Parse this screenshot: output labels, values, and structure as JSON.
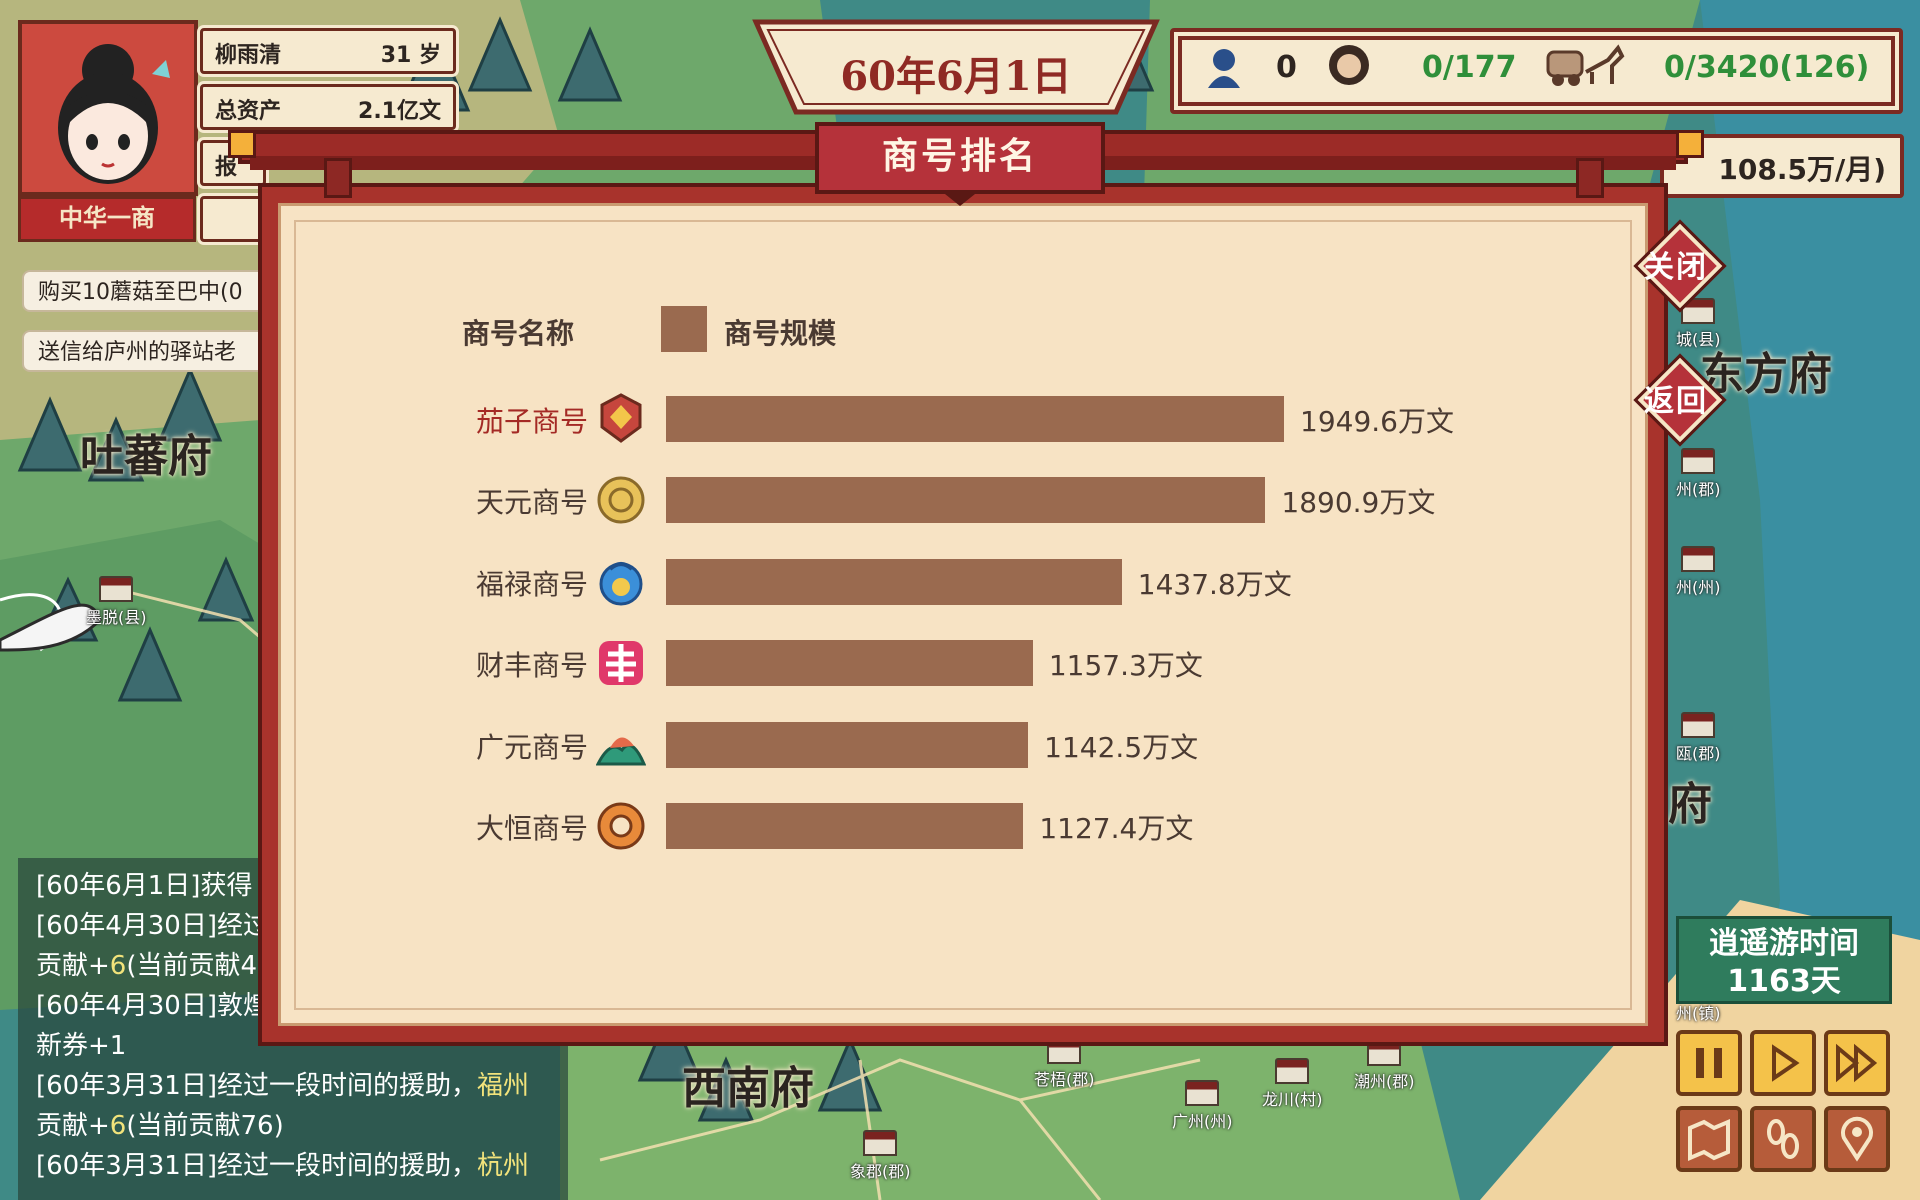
{
  "player": {
    "name": "柳雨清",
    "age": "31 岁",
    "assets_label": "总资产",
    "assets_value": "2.1亿文",
    "title_badge": "中华一商",
    "partial_row_text": "报"
  },
  "quests": [
    "购买10蘑菇至巴中(0",
    "送信给庐州的驿站老"
  ],
  "date": "60年6月1日",
  "stats": {
    "stat1": "0",
    "stat2": "0/177",
    "stat3": "0/3420(126)"
  },
  "income": "108.5万/月)",
  "map_labels": {
    "tubo": "吐蕃府",
    "xinan": "西南府",
    "right_fu_1": "东方府",
    "right_fu_2": "府",
    "modu": "墨脱(县)",
    "cangwu": "苍梧(郡)",
    "guangzhou": "广州(州)",
    "longchuan": "龙川(村)",
    "chaozhou": "潮州(郡)",
    "xiangjun": "象郡(郡)",
    "r_city_1": "城(县)",
    "r_city_2": "州(郡)",
    "r_city_3": "州(州)",
    "r_city_4": "瓯(郡)",
    "r_city_5": "州(镇)"
  },
  "modal": {
    "title": "商号排名",
    "close": "关闭",
    "back": "返回",
    "col_name": "商号名称",
    "col_scale": "商号规模"
  },
  "chart_data": {
    "type": "bar",
    "title": "商号排名",
    "legend": "商号规模",
    "categories": [
      "茄子商号",
      "天元商号",
      "福禄商号",
      "财丰商号",
      "广元商号",
      "大恒商号"
    ],
    "values": [
      1949.6,
      1890.9,
      1437.8,
      1157.3,
      1142.5,
      1127.4
    ],
    "value_labels": [
      "1949.6万文",
      "1890.9万文",
      "1437.8万文",
      "1157.3万文",
      "1142.5万文",
      "1127.4万文"
    ],
    "unit": "万文",
    "bar_color": "#9a6a4f",
    "highlight_color": "#a42a25",
    "highlight_index": 0
  },
  "log": {
    "lines": [
      {
        "text": "[60年6月1日]获得",
        "hl": ""
      },
      {
        "text": "[60年4月30日]经过",
        "hl": ""
      },
      {
        "text": "贡献+",
        "hl": "6",
        "tail": "(当前贡献4"
      },
      {
        "text": "[60年4月30日]敦煌",
        "hl": ""
      },
      {
        "text": "新券+1",
        "hl": ""
      },
      {
        "text": "[60年3月31日]经过一段时间的援助，",
        "hl": "福州",
        "tail": ""
      },
      {
        "text": "贡献+",
        "hl": "6",
        "tail": "(当前贡献76)"
      },
      {
        "text": "[60年3月31日]经过一段时间的援助，",
        "hl": "杭州",
        "tail": ""
      }
    ]
  },
  "travel": {
    "label": "逍遥游时间",
    "days": "1163天"
  }
}
